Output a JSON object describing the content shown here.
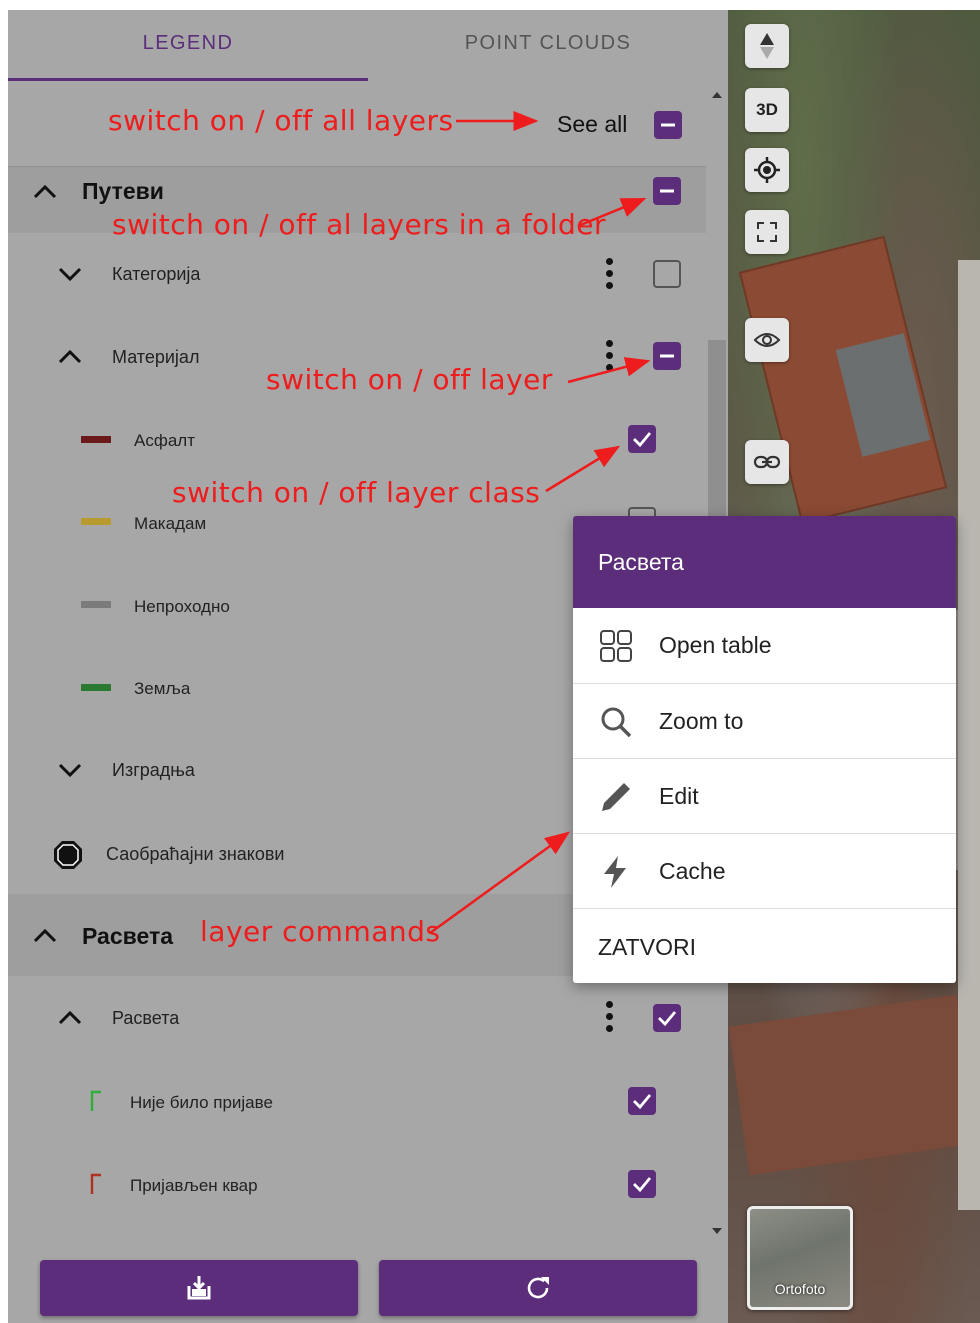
{
  "tabs": [
    {
      "label": "LEGEND",
      "active": true
    },
    {
      "label": "POINT CLOUDS",
      "active": false
    }
  ],
  "see_all": {
    "label": "See all",
    "state": "indeterminate"
  },
  "layers": {
    "putevi": {
      "label": "Путеви",
      "state": "indeterminate"
    },
    "kategorija": {
      "label": "Категорија",
      "state": "off"
    },
    "materijal": {
      "label": "Материјал",
      "state": "indeterminate"
    },
    "classes": [
      {
        "label": "Асфалт",
        "color": "#6b1a1a",
        "checked": true
      },
      {
        "label": "Макадам",
        "color": "#b89a2e",
        "checked": false
      },
      {
        "label": "Непроходно",
        "color": "#7b7b7b"
      },
      {
        "label": "Земља",
        "color": "#2c7a32"
      }
    ],
    "izgradnja": {
      "label": "Изградња"
    },
    "saobracajni": {
      "label": "Саобраћајни знакови"
    },
    "rasveta_folder": {
      "label": "Расвета"
    },
    "rasveta_layer": {
      "label": "Расвета",
      "state": "on"
    },
    "rasveta_classes": [
      {
        "label": "Није било пријаве",
        "color": "#2fae3b",
        "checked": true
      },
      {
        "label": "Пријављен квар",
        "color": "#b0311f",
        "checked": true
      }
    ]
  },
  "menu": {
    "title": "Расвета",
    "items": [
      {
        "label": "Open table",
        "icon": "grid-icon"
      },
      {
        "label": "Zoom to",
        "icon": "search-icon"
      },
      {
        "label": "Edit",
        "icon": "pencil-icon"
      },
      {
        "label": "Cache",
        "icon": "bolt-icon"
      }
    ],
    "close_label": "ZATVORI"
  },
  "map": {
    "buttons": [
      "compass-icon",
      "3D",
      "locate-icon",
      "fullscreen-icon",
      "eye-icon",
      "link-icon"
    ],
    "label_3d": "3D",
    "basemap_label": "Ortofoto"
  },
  "annotations": {
    "all_layers": "switch on / off all layers",
    "folder": "switch on / off al layers in a folder",
    "layer": "switch on / off layer",
    "layer_class": "switch on / off layer class",
    "commands": "layer commands"
  },
  "colors": {
    "accent": "#5b2d7a",
    "annotation": "#ee1c1c"
  }
}
